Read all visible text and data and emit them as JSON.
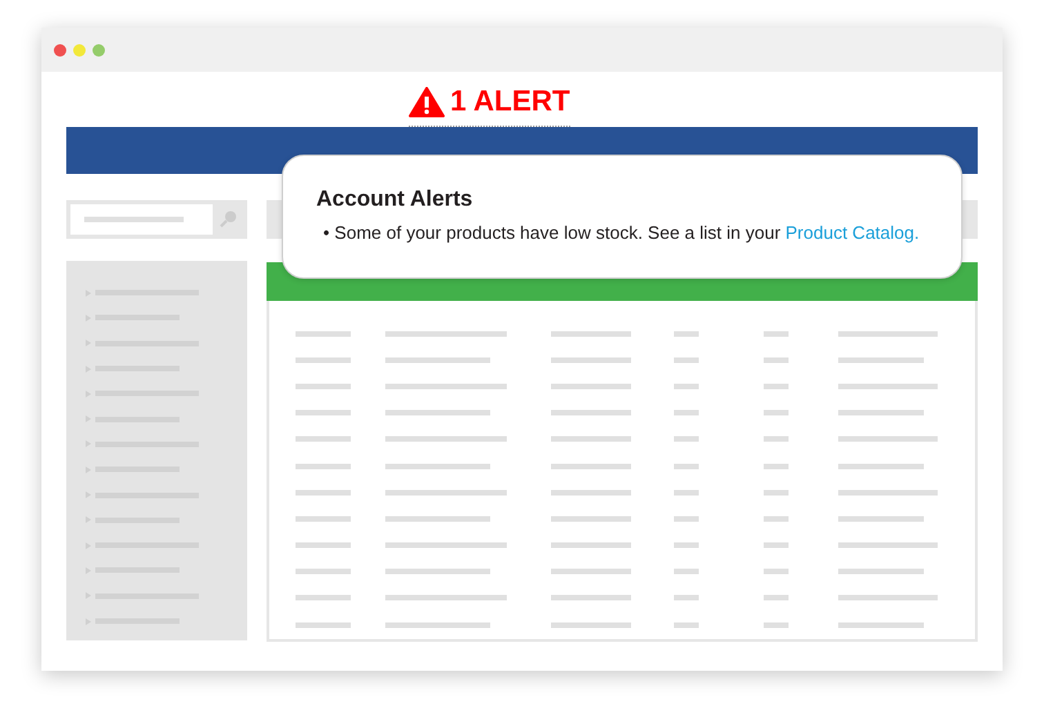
{
  "alert_banner": {
    "text": "1 ALERT"
  },
  "popup": {
    "title": "Account Alerts",
    "items": [
      {
        "bullet": "•",
        "text": "Some of your products have low stock. See a list in your ",
        "link": "Product Catalog."
      }
    ]
  }
}
